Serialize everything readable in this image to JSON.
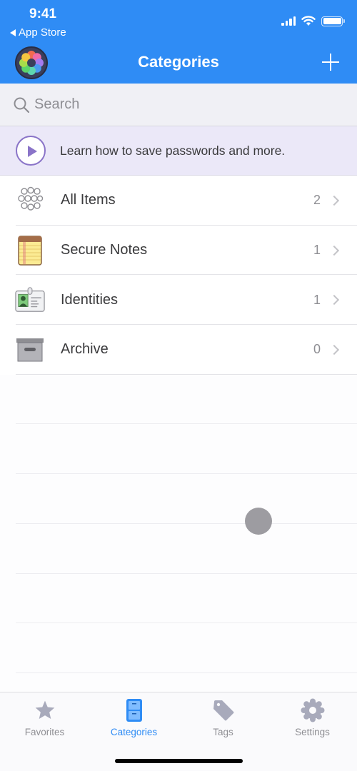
{
  "status_bar": {
    "time": "9:41",
    "back_label": "App Store"
  },
  "header": {
    "title": "Categories",
    "add_button": "plus-icon"
  },
  "search": {
    "placeholder": "Search"
  },
  "promo": {
    "text": "Learn how to save passwords and more."
  },
  "categories": [
    {
      "label": "All Items",
      "count": "2",
      "icon": "all-items-icon"
    },
    {
      "label": "Secure Notes",
      "count": "1",
      "icon": "secure-notes-icon"
    },
    {
      "label": "Identities",
      "count": "1",
      "icon": "identity-card-icon"
    },
    {
      "label": "Archive",
      "count": "0",
      "icon": "archive-box-icon"
    }
  ],
  "tabbar": {
    "tabs": [
      {
        "label": "Favorites",
        "icon": "star-icon",
        "active": false
      },
      {
        "label": "Categories",
        "icon": "file-cabinet-icon",
        "active": true
      },
      {
        "label": "Tags",
        "icon": "tag-icon",
        "active": false
      },
      {
        "label": "Settings",
        "icon": "gear-icon",
        "active": false
      }
    ]
  },
  "colors": {
    "accent": "#2f8cf5",
    "promo_background": "#ebe8f8",
    "promo_accent": "#8a74c8",
    "inactive_tab": "#8e8e93"
  }
}
